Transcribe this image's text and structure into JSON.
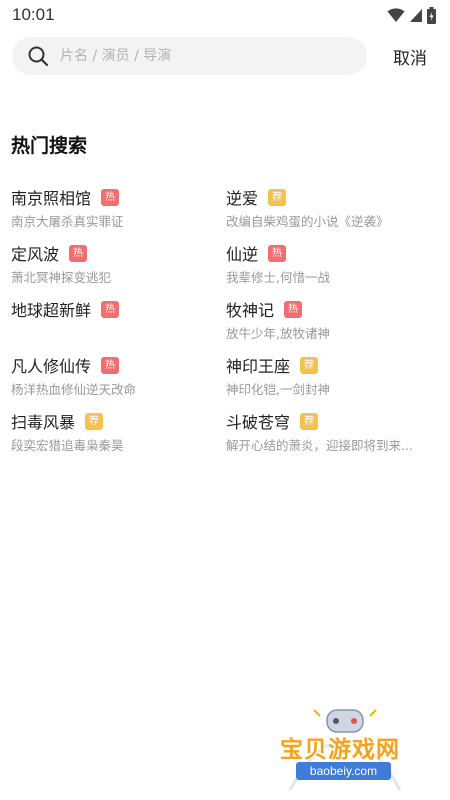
{
  "status_bar": {
    "time": "10:01"
  },
  "search": {
    "placeholder": "片名 / 演员 / 导演",
    "cancel_label": "取消"
  },
  "hot_search": {
    "title": "热门搜索",
    "tag_labels": {
      "hot": "热",
      "rec": "荐"
    },
    "items": [
      {
        "title": "南京照相馆",
        "tag": "热",
        "tag_type": "hot",
        "desc": "南京大屠杀真实罪证"
      },
      {
        "title": "逆爱",
        "tag": "荐",
        "tag_type": "rec",
        "desc": "改编自柴鸡蛋的小说《逆袭》"
      },
      {
        "title": "定风波",
        "tag": "热",
        "tag_type": "hot",
        "desc": "萧北冥神探变逃犯"
      },
      {
        "title": "仙逆",
        "tag": "热",
        "tag_type": "hot",
        "desc": "我辈修士,何惜一战"
      },
      {
        "title": "地球超新鲜",
        "tag": "热",
        "tag_type": "hot",
        "desc": ""
      },
      {
        "title": "牧神记",
        "tag": "热",
        "tag_type": "hot",
        "desc": "放牛少年,放牧诸神"
      },
      {
        "title": "凡人修仙传",
        "tag": "热",
        "tag_type": "hot",
        "desc": "杨洋热血修仙逆天改命"
      },
      {
        "title": "神印王座",
        "tag": "荐",
        "tag_type": "rec",
        "desc": "神印化铠,一剑封神"
      },
      {
        "title": "扫毒风暴",
        "tag": "荐",
        "tag_type": "rec",
        "desc": "段奕宏猎追毒枭秦昊"
      },
      {
        "title": "斗破苍穹",
        "tag": "荐",
        "tag_type": "rec",
        "desc": "解开心结的萧炎，迎接即将到来..."
      }
    ]
  },
  "watermark": {
    "name": "宝贝游戏网",
    "url": "baobeiy.com"
  },
  "colors": {
    "hot_tag": "#f26d6d",
    "rec_tag": "#f5c14f",
    "search_bg": "#f3f3f3"
  }
}
